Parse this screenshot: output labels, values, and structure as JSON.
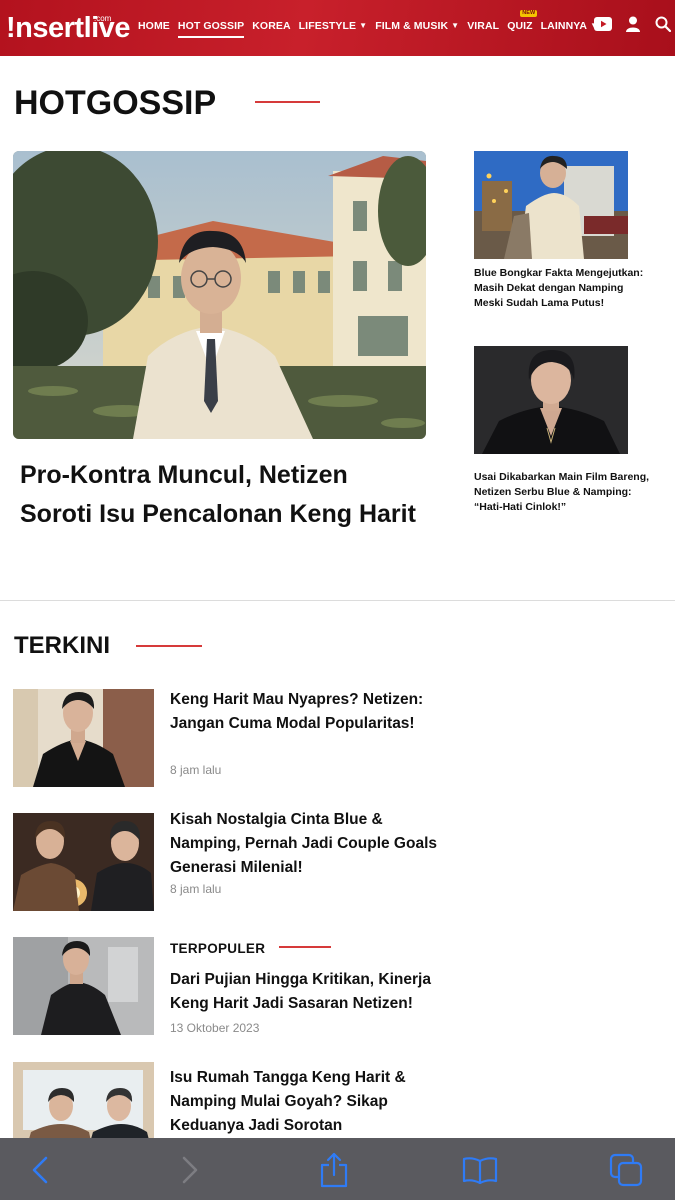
{
  "brand": {
    "logo_text": "!nsertlive",
    "logo_suffix": ".com"
  },
  "nav": {
    "items": [
      {
        "label": "HOME",
        "dropdown": false
      },
      {
        "label": "HOT GOSSIP",
        "dropdown": false,
        "active": true
      },
      {
        "label": "KOREA",
        "dropdown": false
      },
      {
        "label": "LIFESTYLE",
        "dropdown": true
      },
      {
        "label": "FILM & MUSIK",
        "dropdown": true
      },
      {
        "label": "VIRAL",
        "dropdown": false
      },
      {
        "label": "QUIZ",
        "dropdown": false,
        "badge": "NEW"
      },
      {
        "label": "LAINNYA",
        "dropdown": true
      }
    ],
    "icons": [
      "youtube-icon",
      "user-icon",
      "search-icon"
    ]
  },
  "hotgossip": {
    "heading": "HOTGOSSIP",
    "hero": {
      "title": "Pro-Kontra Muncul, Netizen Soroti Isu Pencalonan Keng Harit"
    },
    "side": [
      {
        "title": "Blue Bongkar Fakta Mengejutkan: Masih Dekat dengan Namping Meski Sudah Lama Putus!"
      },
      {
        "title": "Usai Dikabarkan Main Film Bareng, Netizen Serbu Blue & Namping: “Hati-Hati Cinlok!”"
      }
    ]
  },
  "terkini": {
    "heading": "TERKINI",
    "items": [
      {
        "title": "Keng Harit Mau Nyapres? Netizen: Jangan Cuma Modal Popularitas!",
        "time": "8 jam lalu"
      },
      {
        "title": "Kisah Nostalgia Cinta Blue & Namping, Pernah Jadi Couple Goals Generasi Milenial!",
        "time": "8 jam lalu"
      },
      {
        "kicker": "TERPOPULER",
        "title": "Dari Pujian Hingga Kritikan, Kinerja Keng Harit Jadi Sasaran Netizen!",
        "time": "13 Oktober 2023"
      },
      {
        "title": "Isu Rumah Tangga Keng Harit & Namping Mulai Goyah? Sikap Keduanya Jadi Sorotan",
        "time": ""
      }
    ]
  },
  "colors": {
    "brand_red": "#c41a24",
    "accent_line": "#d63a3a",
    "toolbar": "#5a5a5f",
    "ios_blue": "#2f7bf5"
  },
  "browser_toolbar": {
    "icons": [
      "back-icon",
      "forward-icon",
      "share-icon",
      "bookmarks-icon",
      "tabs-icon"
    ]
  }
}
